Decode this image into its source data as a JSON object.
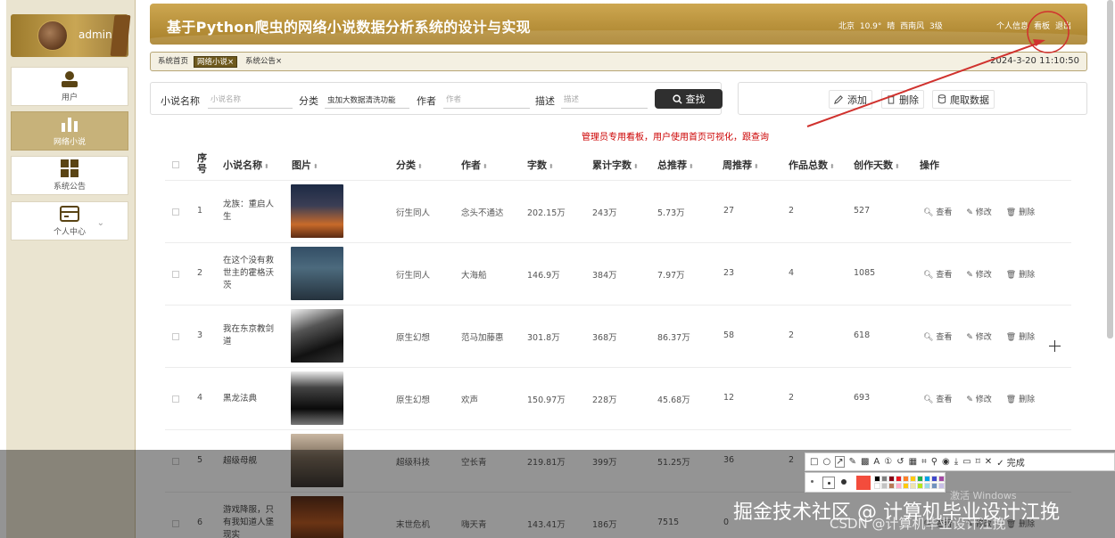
{
  "sidebar": {
    "username": "admin",
    "items": [
      {
        "label": "用户",
        "icon": "user-icon",
        "active": false
      },
      {
        "label": "网络小说",
        "icon": "bar-chart-icon",
        "active": true
      },
      {
        "label": "系统公告",
        "icon": "grid-icon",
        "active": false
      },
      {
        "label": "个人中心",
        "icon": "card-icon",
        "active": false
      }
    ]
  },
  "header": {
    "title": "基于Python爬虫的网络小说数据分析系统的设计与实现",
    "weather": "北京  10.9°  晴  西南风  3级",
    "links": [
      "个人信息",
      "看板",
      "退出"
    ]
  },
  "tabs": [
    {
      "label": "系统首页"
    },
    {
      "label": "网络小说×",
      "active": true
    },
    {
      "label": "系统公告×"
    }
  ],
  "datetime": "2024-3-20 11:10:50",
  "search": {
    "name_label": "小说名称",
    "name_placeholder": "小说名称",
    "category_label": "分类",
    "category_value": "虫加大数据清洗功能",
    "author_label": "作者",
    "author_placeholder": "作者",
    "desc_label": "描述",
    "desc_placeholder": "描述",
    "button": "查找"
  },
  "actions": {
    "add": "添加",
    "delete": "删除",
    "crawl": "爬取数据"
  },
  "annotation": "管理员专用看板，用户使用首页可视化，跟查询",
  "table": {
    "headers": [
      "序号",
      "小说名称",
      "图片",
      "分类",
      "作者",
      "字数",
      "累计字数",
      "总推荐",
      "周推荐",
      "作品总数",
      "创作天数",
      "操作"
    ],
    "ops": {
      "view": "查看",
      "edit": "修改",
      "delete": "删除"
    },
    "rows": [
      {
        "no": "1",
        "name": "龙族：重启人生",
        "category": "衍生同人",
        "author": "念头不通达",
        "words": "202.15万",
        "total_words": "243万",
        "total_rec": "5.73万",
        "week_rec": "27",
        "works": "2",
        "days": "527"
      },
      {
        "no": "2",
        "name": "在这个没有救世主的霍格沃茨",
        "category": "衍生同人",
        "author": "大海船",
        "words": "146.9万",
        "total_words": "384万",
        "total_rec": "7.97万",
        "week_rec": "23",
        "works": "4",
        "days": "1085"
      },
      {
        "no": "3",
        "name": "我在东京教剑道",
        "category": "原生幻想",
        "author": "范马加藤惠",
        "words": "301.8万",
        "total_words": "368万",
        "total_rec": "86.37万",
        "week_rec": "58",
        "works": "2",
        "days": "618"
      },
      {
        "no": "4",
        "name": "黑龙法典",
        "category": "原生幻想",
        "author": "欢声",
        "words": "150.97万",
        "total_words": "228万",
        "total_rec": "45.68万",
        "week_rec": "12",
        "works": "2",
        "days": "693"
      },
      {
        "no": "5",
        "name": "超级母舰",
        "category": "超级科技",
        "author": "空长青",
        "words": "219.81万",
        "total_words": "399万",
        "total_rec": "51.25万",
        "week_rec": "36",
        "works": "2",
        "days": ""
      },
      {
        "no": "6",
        "name": "游戏降服，只有我知道人堡现实",
        "category": "末世危机",
        "author": "嗨天青",
        "words": "143.41万",
        "total_words": "186万",
        "total_rec": "7515",
        "week_rec": "0",
        "works": "",
        "days": ""
      }
    ]
  },
  "screenshot_toolbar": {
    "done": "完成"
  },
  "watermark": "掘金技术社区 @ 计算机毕业设计江挽",
  "watermark_csdn": "CSDN @计算机毕业设计江挽",
  "windows_activate": "激活 Windows",
  "colors": {
    "accent_gold": "#b8912f",
    "active_nav": "#c7b27a",
    "annotation_red": "#cc0000",
    "search_button": "#2f2f2f"
  }
}
